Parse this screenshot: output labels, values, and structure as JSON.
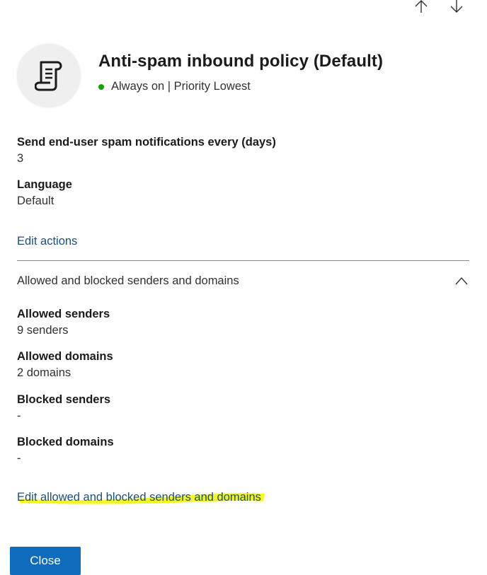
{
  "panel": {
    "title": "Anti-spam inbound policy (Default)",
    "status": "Always on | Priority Lowest",
    "status_color": "#13a10e",
    "icon": "scroll-icon"
  },
  "notifications": {
    "fields": [
      {
        "label": "Send end-user spam notifications every (days)",
        "value": "3"
      },
      {
        "label": "Language",
        "value": "Default"
      }
    ],
    "edit_link": "Edit actions"
  },
  "allowed_blocked": {
    "section_title": "Allowed and blocked senders and domains",
    "expanded": true,
    "fields": [
      {
        "label": "Allowed senders",
        "value": "9 senders"
      },
      {
        "label": "Allowed domains",
        "value": "2 domains"
      },
      {
        "label": "Blocked senders",
        "value": "-"
      },
      {
        "label": "Blocked domains",
        "value": "-"
      }
    ],
    "edit_link": "Edit allowed and blocked senders and domains",
    "highlight_color": "#f5f500"
  },
  "footer": {
    "close_label": "Close",
    "accent": "#0f6cbd"
  },
  "nav": {
    "up_icon": "arrow-up-icon",
    "down_icon": "arrow-down-icon"
  }
}
